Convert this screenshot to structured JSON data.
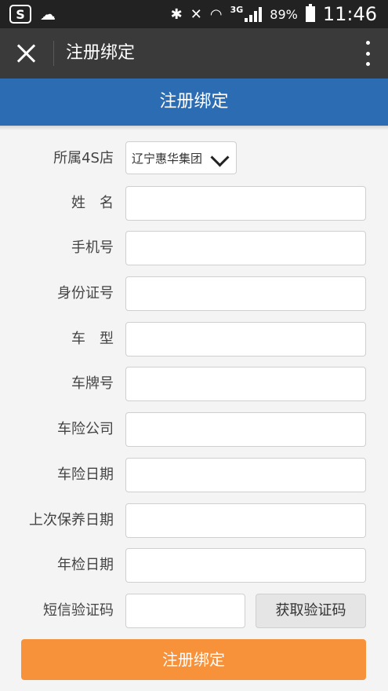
{
  "status_bar": {
    "app_icon_1": "S",
    "app_icon_2": "cloud-alert-icon",
    "bluetooth_icon": "∦",
    "silent_icon": "⨯",
    "network": "3G",
    "battery": "89%",
    "time": "11:46"
  },
  "app_bar": {
    "title": "注册绑定"
  },
  "page_header": {
    "title": "注册绑定"
  },
  "form": {
    "dealer_label": "所属4S店",
    "dealer_value": "辽宁惠华集团",
    "name_label": "姓　名",
    "phone_label": "手机号",
    "id_label": "身份证号",
    "model_label": "车　型",
    "plate_label": "车牌号",
    "insurer_label": "车险公司",
    "insurance_date_label": "车险日期",
    "last_service_label": "上次保养日期",
    "inspection_label": "年检日期",
    "sms_label": "短信验证码",
    "get_code_label": "获取验证码"
  },
  "submit_label": "注册绑定",
  "colors": {
    "status_bar": "#222222",
    "app_bar": "#3a3a3a",
    "page_header": "#2c6cb3",
    "submit": "#f7923b",
    "background": "#f4f4f4"
  }
}
